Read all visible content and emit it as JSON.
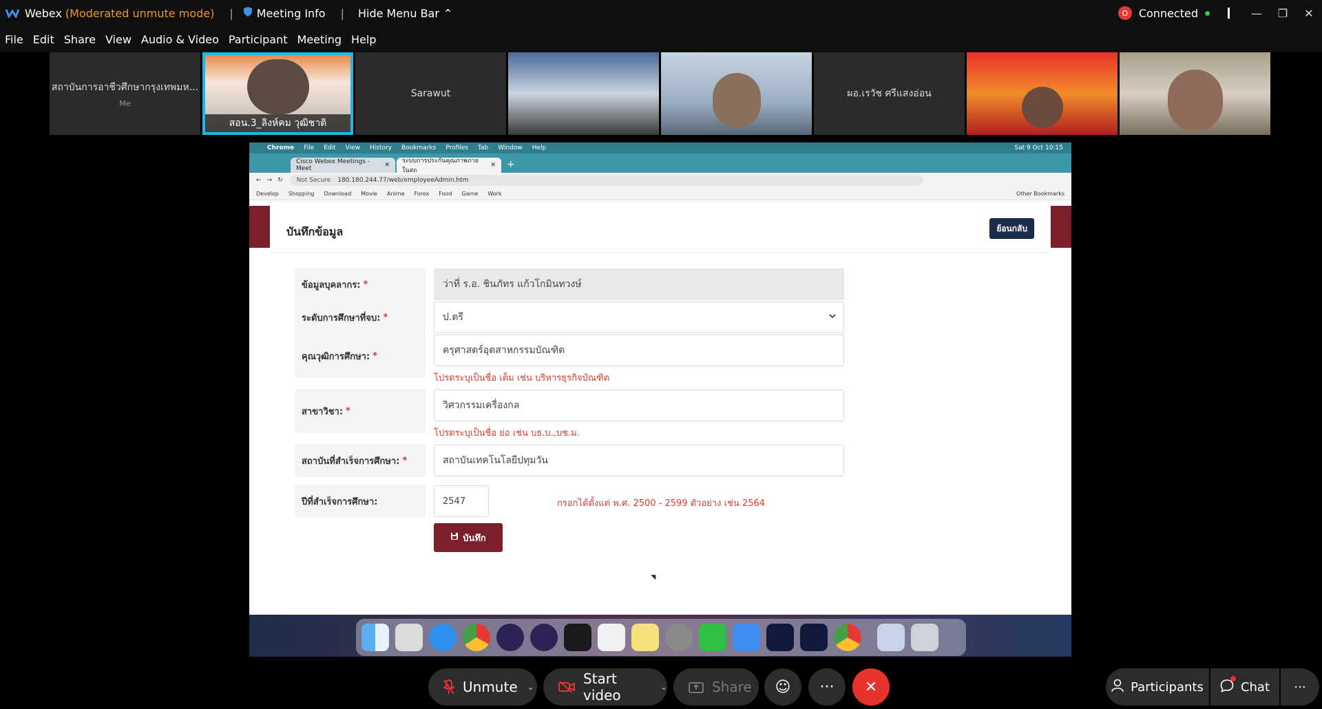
{
  "titlebar": {
    "app_name": "Webex",
    "mode": "(Moderated unmute mode)",
    "separator": "|",
    "meeting_info": "Meeting Info",
    "hide_menu": "Hide Menu Bar",
    "connected": "Connected"
  },
  "menu": [
    "File",
    "Edit",
    "Share",
    "View",
    "Audio & Video",
    "Participant",
    "Meeting",
    "Help"
  ],
  "participants": [
    {
      "name": "สถาบันการอาชีวศึกษากรุงเทพมห...",
      "sub": "Me"
    },
    {
      "name": "สอน.3_ลิงห์คม วุฒิชาติ"
    },
    {
      "name": "Sarawut"
    },
    {
      "name": ""
    },
    {
      "name": ""
    },
    {
      "name": "ผอ.เรวัช ศรีแสงอ่อน"
    },
    {
      "name": ""
    },
    {
      "name": ""
    }
  ],
  "browser": {
    "mac_menu": [
      "Chrome",
      "File",
      "Edit",
      "View",
      "History",
      "Bookmarks",
      "Profiles",
      "Tab",
      "Window",
      "Help"
    ],
    "clock": "Sat 9 Oct 10:15",
    "tabs": [
      "Cisco Webex Meetings - Meet",
      "ระบบการประกันคุณภาพภายในสถ"
    ],
    "not_secure": "Not Secure",
    "url": "180.180.244.77/web/employeeAdmin.htm",
    "bookmarks": [
      "Develop",
      "Shopping",
      "Download",
      "Movie",
      "Anime",
      "Forex",
      "Food",
      "Game",
      "Work"
    ],
    "other_bookmarks": "Other Bookmarks"
  },
  "form": {
    "title": "บันทึกข้อมูล",
    "back_button": "ย้อนกลับ",
    "req_mark": "*",
    "fields": [
      {
        "label": "ข้อมูลบุคลากร:",
        "value": "ว่าที่ ร.อ. ชินภัทร แก้วโกมินทวงษ์"
      },
      {
        "label": "ระดับการศึกษาที่จบ:",
        "value": "ป.ตรี"
      },
      {
        "label": "คุณวุฒิการศึกษา:",
        "value": "ครุศาสตร์อุตสาหกรรมบัณฑิต",
        "hint": "โปรดระบุเป็นชื่อ เต็ม เช่น บริหารธุรกิจบัณฑิต"
      },
      {
        "label": "สาขาวิชา:",
        "value": "วิศวกรรมเครื่องกล",
        "hint": "โปรดระบุเป็นชื่อ ย่อ เช่น บธ.บ.,บช.ม."
      },
      {
        "label": "สถาบันที่สำเร็จการศึกษา:",
        "value": "สถาบันเทคโนโลยีปทุมวัน"
      },
      {
        "label": "ปีที่สำเร็จการศึกษา:",
        "value": "2547",
        "hint": "กรอกได้ตั้งแต่ พ.ศ. 2500 - 2599 ตัวอย่าง เช่น 2564"
      }
    ],
    "save_button": "บันทึก"
  },
  "toolbar": {
    "unmute": "Unmute",
    "start_video": "Start video",
    "share": "Share",
    "participants": "Participants",
    "chat": "Chat"
  },
  "colors": {
    "accent_red": "#7b1f2a",
    "hint_red": "#dd3b2e",
    "active_tile": "#1fb6e8",
    "end_button": "#e8332c",
    "mode_orange": "#f09a1a"
  }
}
